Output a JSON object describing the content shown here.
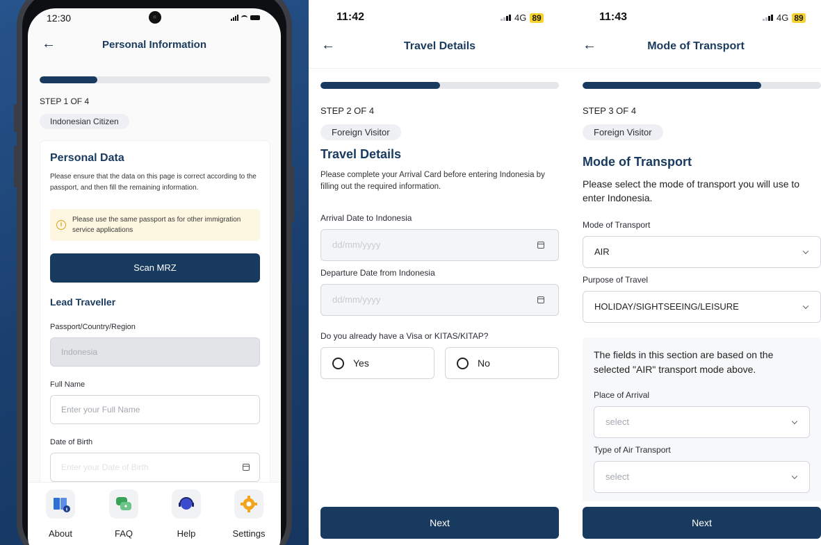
{
  "screen1": {
    "status": {
      "time": "12:30"
    },
    "header": {
      "title": "Personal Information"
    },
    "progress": {
      "fraction": 0.25
    },
    "step": "STEP 1 OF 4",
    "chip": "Indonesian Citizen",
    "card": {
      "title": "Personal Data",
      "description": "Please ensure that the data on this page is correct according to the passport, and then fill the remaining information.",
      "note": "Please use the same passport as for other immigration service applications",
      "scan_button": "Scan MRZ",
      "section_title": "Lead Traveller",
      "passport_label": "Passport/Country/Region",
      "passport_value": "Indonesia",
      "fullname_label": "Full Name",
      "fullname_placeholder": "Enter your Full Name",
      "dob_label": "Date of Birth",
      "dob_placeholder": "Enter your Date of Birth"
    },
    "tabs": [
      {
        "label": "About",
        "icon": "book-info-icon",
        "color": "#2f6fd6"
      },
      {
        "label": "FAQ",
        "icon": "chat-question-icon",
        "color": "#3aa35a"
      },
      {
        "label": "Help",
        "icon": "headset-icon",
        "color": "#3b4ccf"
      },
      {
        "label": "Settings",
        "icon": "gear-icon",
        "color": "#f2a51c"
      }
    ]
  },
  "screen2": {
    "status": {
      "time": "11:42",
      "network": "4G",
      "battery": "89"
    },
    "header": {
      "title": "Travel Details"
    },
    "progress": {
      "fraction": 0.5
    },
    "step": "STEP 2 OF 4",
    "chip": "Foreign Visitor",
    "title": "Travel Details",
    "description": "Please complete your Arrival Card before entering Indonesia by filling out the required information.",
    "arrival_label": "Arrival Date to Indonesia",
    "arrival_placeholder": "dd/mm/yyyy",
    "departure_label": "Departure Date from Indonesia",
    "departure_placeholder": "dd/mm/yyyy",
    "visa_question": "Do you already have a Visa or KITAS/KITAP?",
    "yes_label": "Yes",
    "no_label": "No",
    "next_label": "Next"
  },
  "screen3": {
    "status": {
      "time": "11:43",
      "network": "4G",
      "battery": "89"
    },
    "header": {
      "title": "Mode of Transport"
    },
    "progress": {
      "fraction": 0.75
    },
    "step": "STEP 3 OF 4",
    "chip": "Foreign Visitor",
    "title": "Mode of Transport",
    "description": "Please select the mode of transport you will use to enter Indonesia.",
    "mode_label": "Mode of Transport",
    "mode_value": "AIR",
    "purpose_label": "Purpose of Travel",
    "purpose_value": "HOLIDAY/SIGHTSEEING/LEISURE",
    "section_note": "The fields in this section are based on the selected \"AIR\" transport mode above.",
    "arrival_place_label": "Place of Arrival",
    "arrival_place_placeholder": "select",
    "air_type_label": "Type of Air Transport",
    "air_type_placeholder": "select",
    "next_label": "Next"
  }
}
